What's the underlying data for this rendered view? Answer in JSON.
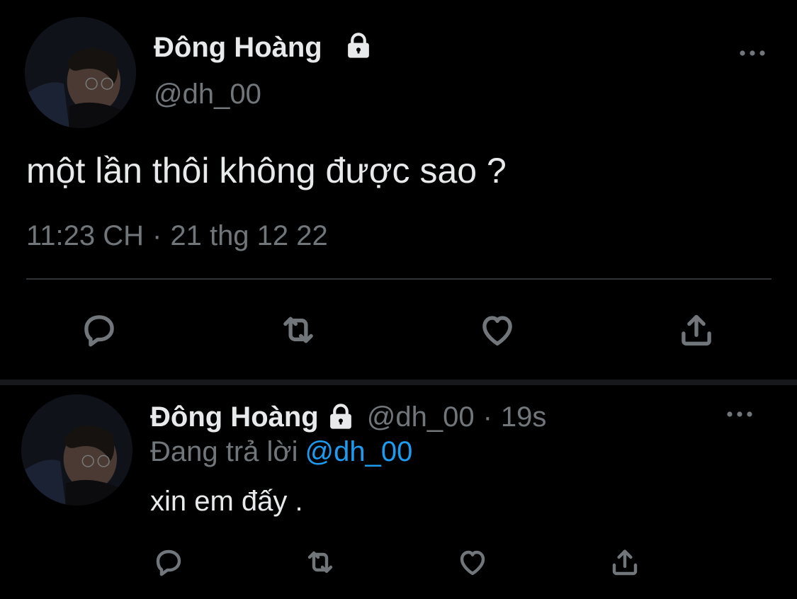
{
  "main_tweet": {
    "author_name": "Đông Hoàng",
    "handle": "@dh_00",
    "text": "một lần thôi không được sao ?",
    "time": "11:23 CH",
    "separator": "·",
    "date": "21 thg 12 22",
    "icons": {
      "lock": "lock-icon",
      "more": "more-icon",
      "reply": "reply-icon",
      "retweet": "retweet-icon",
      "like": "heart-icon",
      "share": "share-icon"
    }
  },
  "reply_tweet": {
    "author_name": "Đông Hoàng",
    "handle": "@dh_00",
    "separator": "·",
    "time_ago": "19s",
    "replying_to_label": "Đang trả lời",
    "replying_to_handle": "@dh_00",
    "text": "xin em đấy ."
  },
  "colors": {
    "background": "#000000",
    "text_primary": "#e7e9ea",
    "text_secondary": "#71767b",
    "accent": "#1d9bf0",
    "divider": "#2f3336"
  }
}
